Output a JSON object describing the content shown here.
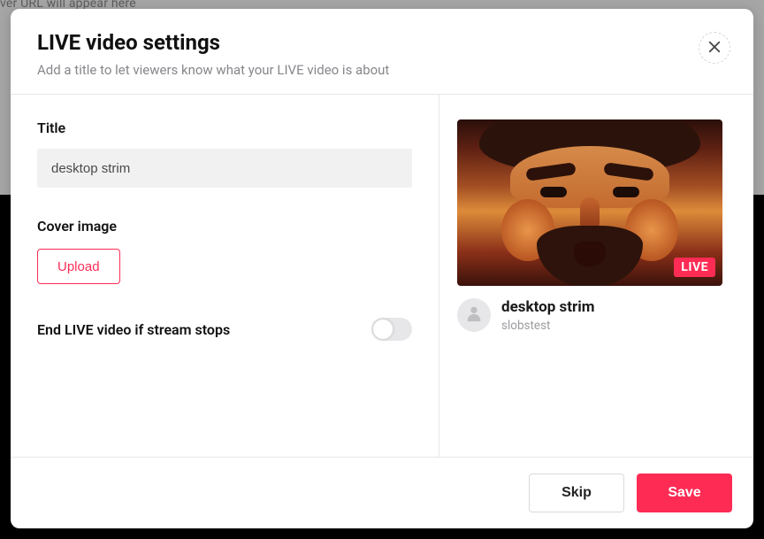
{
  "backdrop_hint": "ver URL will appear here",
  "modal": {
    "title": "LIVE video settings",
    "subtitle": "Add a title to let viewers know what your LIVE video is about"
  },
  "form": {
    "title_label": "Title",
    "title_value": "desktop strim",
    "cover_label": "Cover image",
    "upload_label": "Upload",
    "end_stream_label": "End LIVE video if stream stops",
    "end_stream_on": false
  },
  "preview": {
    "live_badge": "LIVE",
    "title": "desktop strim",
    "username": "slobstest"
  },
  "footer": {
    "skip_label": "Skip",
    "save_label": "Save"
  },
  "colors": {
    "accent": "#fe2c55"
  }
}
